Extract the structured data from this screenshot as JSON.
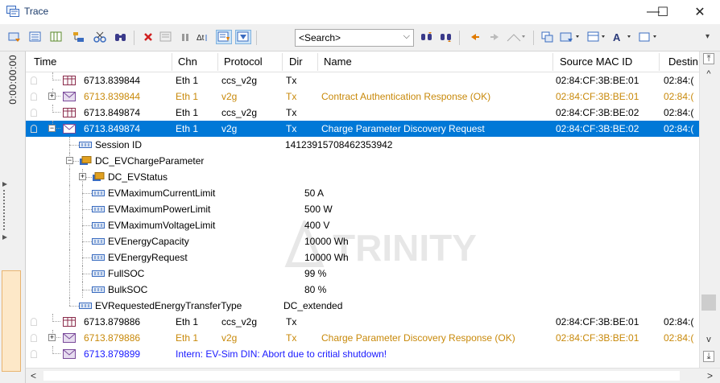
{
  "window": {
    "title": "Trace",
    "minimize": "—",
    "maximize": "☐",
    "close": "✕"
  },
  "toolbar": {
    "search_placeholder": "<Search>",
    "icons": [
      "filter-icon",
      "trace-settings-icon",
      "columns-icon",
      "tree-icon",
      "cut-icon",
      "find-icon",
      "delete-icon",
      "pause-gray-icon",
      "pause-icon",
      "time-format-icon",
      "autoscroll-icon",
      "filter-active-icon",
      "search-down-icon",
      "search-up-icon",
      "prev-icon",
      "next-icon",
      "bookmark-icon",
      "window-icon",
      "export-icon",
      "layout-icon",
      "font-icon",
      "view-icon"
    ]
  },
  "time_strip": {
    "marker": "0:00:00:00"
  },
  "columns": [
    "Time",
    "Chn",
    "Protocol",
    "Dir",
    "Name",
    "Source MAC ID",
    "Destin"
  ],
  "rows": [
    {
      "time": "6713.839844",
      "chn": "Eth 1",
      "protocol": "ccs_v2g",
      "dir": "Tx",
      "name": "",
      "src": "02:84:CF:3B:BE:01",
      "dst": "02:84:(",
      "style": "normal",
      "icon": "frame-icon",
      "expander": ""
    },
    {
      "time": "6713.839844",
      "chn": "Eth 1",
      "protocol": "v2g",
      "dir": "Tx",
      "name": "Contract Authentication Response (OK)",
      "src": "02:84:CF:3B:BE:01",
      "dst": "02:84:(",
      "style": "orange",
      "icon": "message-icon",
      "expander": "+"
    },
    {
      "time": "6713.849874",
      "chn": "Eth 1",
      "protocol": "ccs_v2g",
      "dir": "Tx",
      "name": "",
      "src": "02:84:CF:3B:BE:02",
      "dst": "02:84:(",
      "style": "normal",
      "icon": "frame-icon",
      "expander": ""
    },
    {
      "time": "6713.849874",
      "chn": "Eth 1",
      "protocol": "v2g",
      "dir": "Tx",
      "name": "Charge Parameter Discovery Request",
      "src": "02:84:CF:3B:BE:02",
      "dst": "02:84:(",
      "style": "selected",
      "icon": "message-icon",
      "expander": "−"
    }
  ],
  "tree": [
    {
      "label": "Session ID",
      "value": "14123915708462353942",
      "indent": 1,
      "icon": "field-icon",
      "expander": ""
    },
    {
      "label": "DC_EVChargeParameter",
      "value": "",
      "indent": 1,
      "icon": "struct-icon",
      "expander": "−"
    },
    {
      "label": "DC_EVStatus",
      "value": "",
      "indent": 2,
      "icon": "struct-icon",
      "expander": "+"
    },
    {
      "label": "EVMaximumCurrentLimit",
      "value": "50 A",
      "indent": 2,
      "icon": "field-icon",
      "expander": ""
    },
    {
      "label": "EVMaximumPowerLimit",
      "value": "500 W",
      "indent": 2,
      "icon": "field-icon",
      "expander": ""
    },
    {
      "label": "EVMaximumVoltageLimit",
      "value": "400 V",
      "indent": 2,
      "icon": "field-icon",
      "expander": ""
    },
    {
      "label": "EVEnergyCapacity",
      "value": "10000 Wh",
      "indent": 2,
      "icon": "field-icon",
      "expander": ""
    },
    {
      "label": "EVEnergyRequest",
      "value": "10000 Wh",
      "indent": 2,
      "icon": "field-icon",
      "expander": ""
    },
    {
      "label": "FullSOC",
      "value": "99 %",
      "indent": 2,
      "icon": "field-icon",
      "expander": ""
    },
    {
      "label": "BulkSOC",
      "value": "80 %",
      "indent": 2,
      "icon": "field-icon",
      "expander": ""
    },
    {
      "label": "EVRequestedEnergyTransferType",
      "value": "DC_extended",
      "indent": 1,
      "icon": "field-icon",
      "expander": ""
    }
  ],
  "rows_after": [
    {
      "time": "6713.879886",
      "chn": "Eth 1",
      "protocol": "ccs_v2g",
      "dir": "Tx",
      "name": "",
      "src": "02:84:CF:3B:BE:01",
      "dst": "02:84:(",
      "style": "normal",
      "icon": "frame-icon",
      "expander": ""
    },
    {
      "time": "6713.879886",
      "chn": "Eth 1",
      "protocol": "v2g",
      "dir": "Tx",
      "name": "Charge Parameter Discovery Response (OK)",
      "src": "02:84:CF:3B:BE:01",
      "dst": "02:84:(",
      "style": "orange",
      "icon": "message-icon",
      "expander": "+"
    },
    {
      "time": "6713.879899",
      "chn": "Intern: EV-Sim DIN: Abort due to critial shutdown!",
      "protocol": "",
      "dir": "",
      "name": "",
      "src": "",
      "dst": "",
      "style": "blue",
      "icon": "message-icon",
      "expander": ""
    }
  ],
  "colors": {
    "selection": "#0078d7",
    "orange_text": "#c8890a",
    "blue_text": "#1a1aff"
  }
}
